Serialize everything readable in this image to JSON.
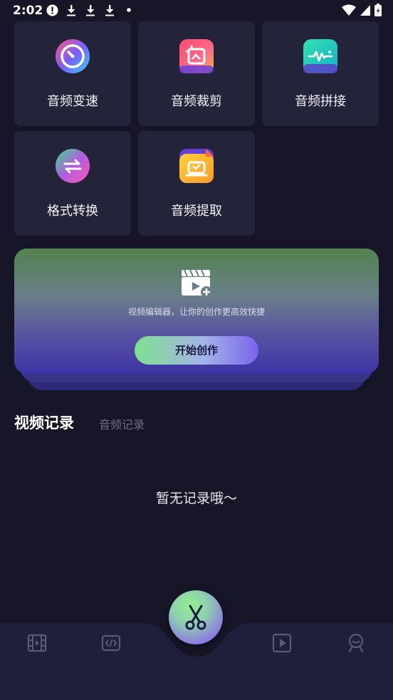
{
  "status_bar": {
    "time": "2:02",
    "left_icons": [
      "alert-icon",
      "download-icon",
      "download-icon",
      "download-icon",
      "dot-icon"
    ],
    "right_icons": [
      "wifi-icon",
      "signal-icon",
      "battery-icon"
    ]
  },
  "tools": [
    {
      "label": "音频变速",
      "icon": "speed-dial-icon"
    },
    {
      "label": "音频裁剪",
      "icon": "crop-icon"
    },
    {
      "label": "音频拼接",
      "icon": "waveform-icon"
    },
    {
      "label": "格式转换",
      "icon": "convert-icon"
    },
    {
      "label": "音频提取",
      "icon": "extract-icon"
    }
  ],
  "banner": {
    "description": "视频编辑器，让你的创作更高效快捷",
    "button_label": "开始创作",
    "icon": "clapperboard-add-icon"
  },
  "tabs": {
    "video": "视频记录",
    "audio": "音频记录",
    "active": "video"
  },
  "empty_state": "暂无记录哦～",
  "bottom_nav": {
    "items": [
      "film-icon",
      "code-icon",
      "scissors-icon",
      "play-icon",
      "profile-icon"
    ],
    "active": "scissors-icon"
  },
  "colors": {
    "background": "#161628",
    "card": "#23233a",
    "accent_green": "#7fe08f",
    "accent_purple": "#7a64ec",
    "inactive_text": "#6e6e82"
  }
}
